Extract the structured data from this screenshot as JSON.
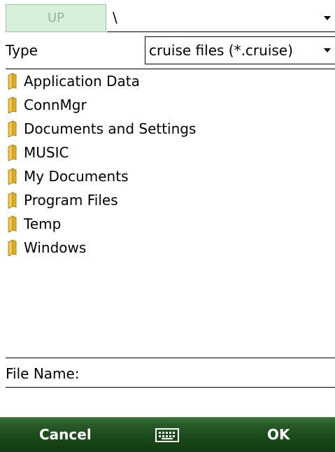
{
  "toolbar": {
    "up_label": "UP",
    "path_value": "\\"
  },
  "type_row": {
    "label": "Type",
    "selected": "cruise files (*.cruise)"
  },
  "folders": [
    {
      "name": "Application Data"
    },
    {
      "name": "ConnMgr"
    },
    {
      "name": "Documents and Settings"
    },
    {
      "name": "MUSIC"
    },
    {
      "name": "My Documents"
    },
    {
      "name": "Program Files"
    },
    {
      "name": "Temp"
    },
    {
      "name": "Windows"
    }
  ],
  "filename": {
    "label": "File Name:",
    "value": ""
  },
  "softkeys": {
    "left": "Cancel",
    "right": "OK",
    "center_icon": "keyboard-icon"
  },
  "colors": {
    "up_bg": "#d8efd9",
    "folder_yellow": "#f2c84b",
    "softkey_bar": "#1c4b1c"
  }
}
